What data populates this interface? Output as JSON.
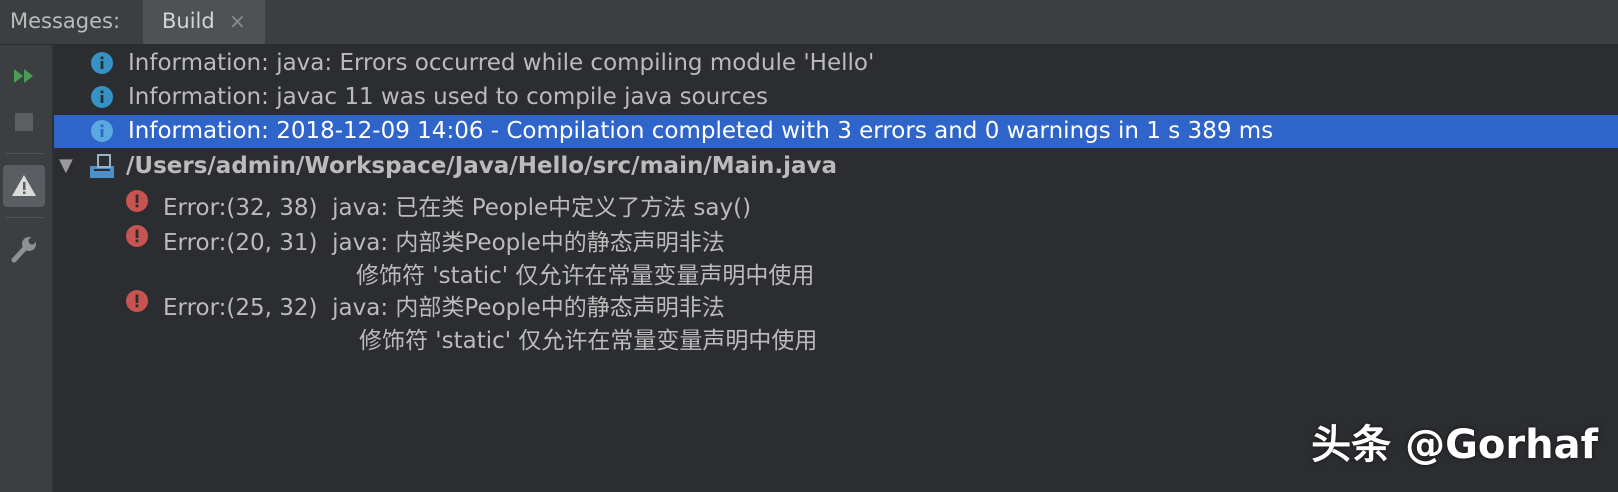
{
  "tabs": {
    "panel_title": "Messages:",
    "active_tab": "Build",
    "close_glyph": "×"
  },
  "toolbar": {
    "icons": [
      "rerun-icon",
      "stop-icon",
      "warning-filter-icon",
      "settings-wrench-icon"
    ]
  },
  "messages": [
    {
      "type": "info",
      "text": "Information: java: Errors occurred while compiling module 'Hello'"
    },
    {
      "type": "info",
      "text": "Information: javac 11 was used to compile java sources"
    },
    {
      "type": "info",
      "selected": true,
      "text": "Information: 2018-12-09 14:06 - Compilation completed with 3 errors and 0 warnings in 1 s 389 ms"
    }
  ],
  "file": {
    "expand_glyph": "▼",
    "path": "/Users/admin/Workspace/Java/Hello/src/main/Main.java"
  },
  "errors": [
    {
      "text": "Error:(32, 38)  java: 已在类 People中定义了方法 say()"
    },
    {
      "text": "Error:(20, 31)  java: 内部类People中的静态声明非法",
      "continuation": "修饰符 'static' 仅允许在常量变量声明中使用"
    },
    {
      "text": "Error:(25, 32)  java: 内部类People中的静态声明非法",
      "continuation": "修饰符 'static' 仅允许在常量变量声明中使用"
    }
  ],
  "colors": {
    "selection": "#2f65ca",
    "info": "#3592c4",
    "error": "#c75450",
    "rerun": "#499c54"
  },
  "watermark": "头条 @Gorhaf"
}
